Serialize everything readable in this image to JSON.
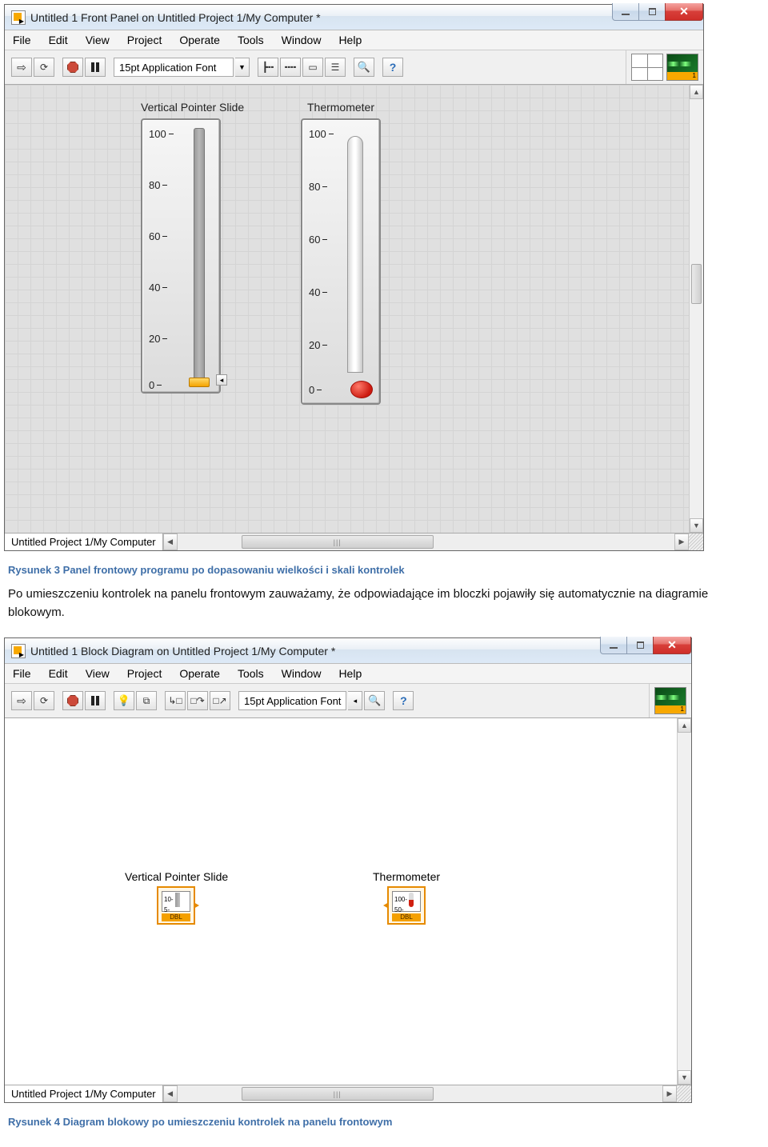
{
  "front_panel": {
    "title": "Untitled 1 Front Panel on Untitled Project 1/My Computer *",
    "menu": {
      "file": "File",
      "edit": "Edit",
      "view": "View",
      "project": "Project",
      "operate": "Operate",
      "tools": "Tools",
      "window": "Window",
      "help": "Help"
    },
    "toolbar": {
      "font": "15pt Application Font"
    },
    "status_path": "Untitled Project 1/My Computer",
    "vi_icon_label": "1",
    "controls": {
      "slide": {
        "label": "Vertical Pointer Slide",
        "ticks": [
          "100",
          "80",
          "60",
          "40",
          "20",
          "0"
        ],
        "value": 0
      },
      "thermo": {
        "label": "Thermometer",
        "ticks": [
          "100",
          "80",
          "60",
          "40",
          "20",
          "0"
        ],
        "value": 0
      }
    }
  },
  "caption3": "Rysunek 3 Panel frontowy programu po dopasowaniu wielkości i skali kontrolek",
  "paragraph": "Po umieszczeniu kontrolek na panelu frontowym zauważamy, że odpowiadające im bloczki pojawiły się automatycznie na diagramie blokowym.",
  "block_diagram": {
    "title": "Untitled 1 Block Diagram on Untitled Project 1/My Computer *",
    "menu": {
      "file": "File",
      "edit": "Edit",
      "view": "View",
      "project": "Project",
      "operate": "Operate",
      "tools": "Tools",
      "window": "Window",
      "help": "Help"
    },
    "toolbar": {
      "font": "15pt Application Font"
    },
    "status_path": "Untitled Project 1/My Computer",
    "vi_icon_label": "1",
    "nodes": {
      "slide": {
        "label": "Vertical Pointer Slide",
        "t1": "10-",
        "t2": "5-",
        "dbl": "DBL"
      },
      "thermo": {
        "label": "Thermometer",
        "t1": "100-",
        "t2": "50-",
        "dbl": "DBL"
      }
    }
  },
  "caption4": "Rysunek 4 Diagram blokowy po umieszczeniu kontrolek na panelu frontowym"
}
